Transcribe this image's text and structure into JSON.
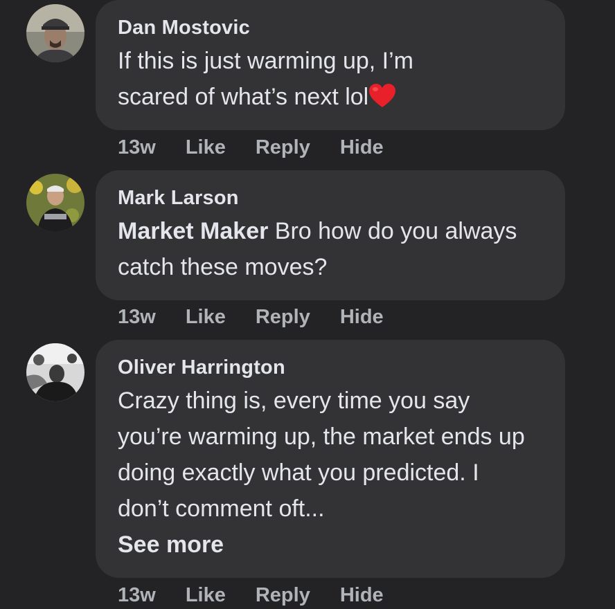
{
  "comments": [
    {
      "author": "Dan Mostovic",
      "mention": "",
      "text_line1": "If this is just warming up, I’m",
      "text_line2": "scared of what’s next lol",
      "emoji": "red-heart",
      "time": "13w",
      "like": "Like",
      "reply": "Reply",
      "hide": "Hide"
    },
    {
      "author": "Mark Larson",
      "mention": "Market Maker",
      "text": " Bro how do you always catch these moves?",
      "time": "13w",
      "like": "Like",
      "reply": "Reply",
      "hide": "Hide"
    },
    {
      "author": "Oliver Harrington",
      "mention": "",
      "text": "Crazy thing is, every time you say you’re warming up, the market ends up doing exactly what you predicted. I don’t comment oft...",
      "see_more": "See more",
      "time": "13w",
      "like": "Like",
      "reply": "Reply",
      "hide": "Hide"
    }
  ],
  "colors": {
    "background": "#232325",
    "bubble": "#333335",
    "text": "#e4e6eb",
    "meta": "#b0b3b8",
    "heart": "#e8202a"
  }
}
